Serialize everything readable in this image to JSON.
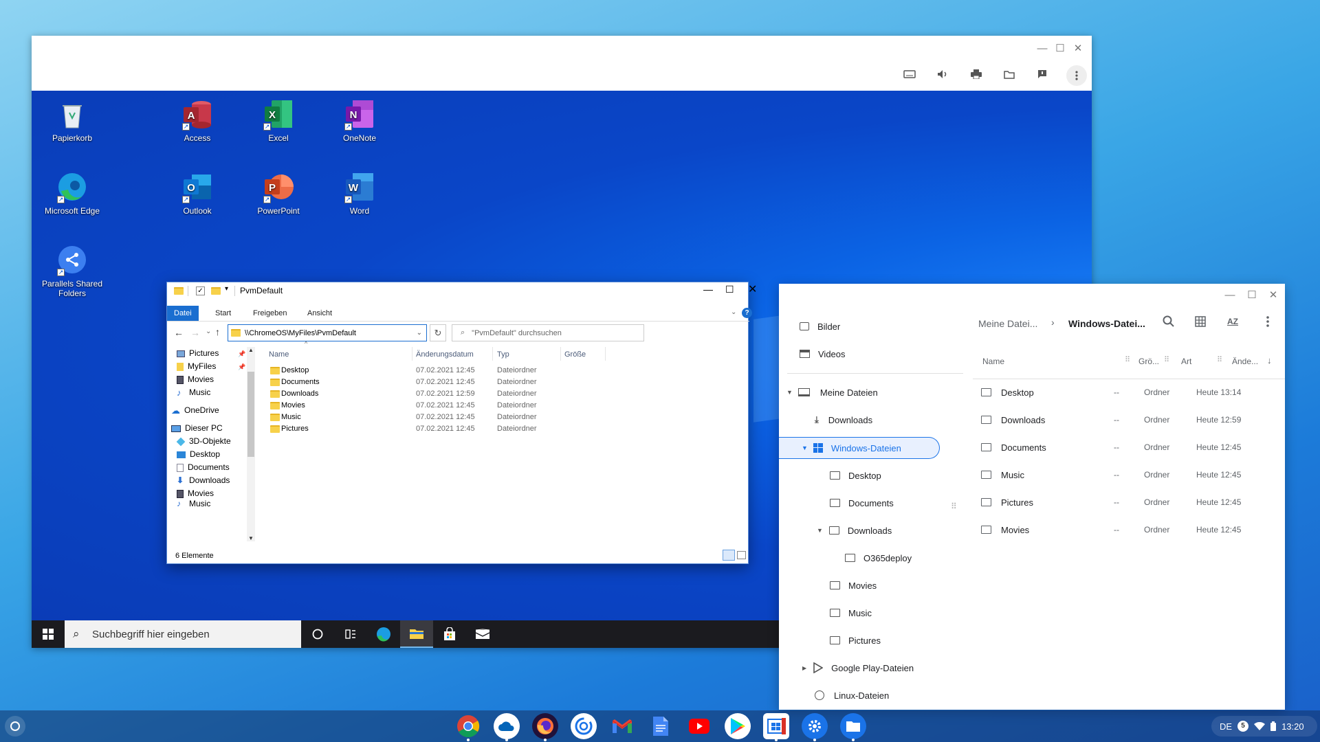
{
  "parallels_toolbar": {
    "icons": [
      "keyboard-icon",
      "speaker-icon",
      "printer-icon",
      "folder-icon",
      "feedback-icon",
      "more-vert-icon"
    ]
  },
  "desktop_icons": [
    {
      "label": "Papierkorb",
      "icon": "recycle-bin-icon"
    },
    {
      "label": "Access",
      "icon": "access-icon"
    },
    {
      "label": "Excel",
      "icon": "excel-icon"
    },
    {
      "label": "OneNote",
      "icon": "onenote-icon"
    },
    {
      "label": "Microsoft Edge",
      "icon": "edge-icon"
    },
    {
      "label": "Outlook",
      "icon": "outlook-icon"
    },
    {
      "label": "PowerPoint",
      "icon": "powerpoint-icon"
    },
    {
      "label": "Word",
      "icon": "word-icon"
    },
    {
      "label": "Parallels Shared Folders",
      "icon": "shared-folders-icon"
    }
  ],
  "win_taskbar": {
    "search_placeholder": "Suchbegriff hier eingeben"
  },
  "explorer": {
    "title": "PvmDefault",
    "ribbon_tabs": [
      "Datei",
      "Start",
      "Freigeben",
      "Ansicht"
    ],
    "address": "\\\\ChromeOS\\MyFiles\\PvmDefault",
    "search_placeholder": "\"PvmDefault\" durchsuchen",
    "nav": {
      "quick": [
        "Pictures",
        "MyFiles",
        "Movies",
        "Music"
      ],
      "onedrive": "OneDrive",
      "pc": "Dieser PC",
      "pc_items": [
        "3D-Objekte",
        "Desktop",
        "Documents",
        "Downloads",
        "Movies",
        "Music"
      ]
    },
    "columns": [
      "Name",
      "Änderungsdatum",
      "Typ",
      "Größe"
    ],
    "rows": [
      {
        "name": "Desktop",
        "date": "07.02.2021 12:45",
        "type": "Dateiordner"
      },
      {
        "name": "Documents",
        "date": "07.02.2021 12:45",
        "type": "Dateiordner"
      },
      {
        "name": "Downloads",
        "date": "07.02.2021 12:59",
        "type": "Dateiordner"
      },
      {
        "name": "Movies",
        "date": "07.02.2021 12:45",
        "type": "Dateiordner"
      },
      {
        "name": "Music",
        "date": "07.02.2021 12:45",
        "type": "Dateiordner"
      },
      {
        "name": "Pictures",
        "date": "07.02.2021 12:45",
        "type": "Dateiordner"
      }
    ],
    "status": "6 Elemente"
  },
  "files_app": {
    "sidebar": {
      "top": [
        "Bilder",
        "Videos"
      ],
      "my_files": "Meine Dateien",
      "downloads": "Downloads",
      "windows": "Windows-Dateien",
      "win_children": [
        "Desktop",
        "Documents",
        "Downloads"
      ],
      "o365": "O365deploy",
      "win_children2": [
        "Movies",
        "Music",
        "Pictures"
      ],
      "play": "Google Play-Dateien",
      "linux": "Linux-Dateien"
    },
    "breadcrumb": [
      "Meine Datei...",
      "Windows-Datei..."
    ],
    "columns": [
      "Name",
      "Grö...",
      "Art",
      "Ände..."
    ],
    "rows": [
      {
        "name": "Desktop",
        "size": "--",
        "type": "Ordner",
        "date": "Heute 13:14"
      },
      {
        "name": "Downloads",
        "size": "--",
        "type": "Ordner",
        "date": "Heute 12:59"
      },
      {
        "name": "Documents",
        "size": "--",
        "type": "Ordner",
        "date": "Heute 12:45"
      },
      {
        "name": "Music",
        "size": "--",
        "type": "Ordner",
        "date": "Heute 12:45"
      },
      {
        "name": "Pictures",
        "size": "--",
        "type": "Ordner",
        "date": "Heute 12:45"
      },
      {
        "name": "Movies",
        "size": "--",
        "type": "Ordner",
        "date": "Heute 12:45"
      }
    ]
  },
  "shelf": {
    "apps": [
      "chrome-icon",
      "onedrive-icon",
      "firefox-icon",
      "parallels-icon",
      "gmail-icon",
      "docs-icon",
      "youtube-icon",
      "play-store-icon",
      "windows-vm-icon",
      "settings-icon",
      "files-icon"
    ],
    "ime": "DE",
    "notification_count": "5",
    "time": "13:20"
  }
}
